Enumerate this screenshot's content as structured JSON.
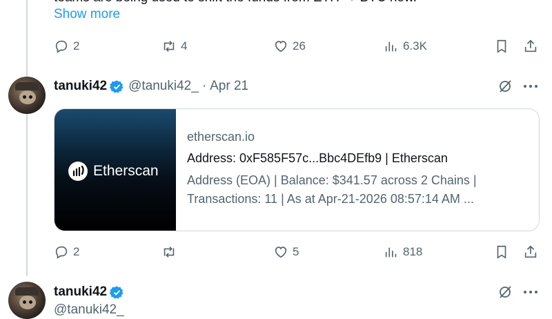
{
  "thread": {
    "cut_text": "teams are being used to shift the funds from ETH → BTC now.",
    "show_more": "Show more",
    "actions": {
      "replies": "2",
      "reposts": "4",
      "likes": "26",
      "views": "6.3K"
    }
  },
  "tweet1": {
    "display_name": "tanuki42",
    "handle": "@tanuki42_",
    "dot": "·",
    "date": "Apr 21",
    "card": {
      "logo_text": "Etherscan",
      "domain": "etherscan.io",
      "title": "Address: 0xF585F57c...Bbc4DEfb9 | Etherscan",
      "description": "Address (EOA) | Balance: $341.57 across 2 Chains | Transactions: 11 | As at Apr-21-2026 08:57:14 AM ..."
    },
    "actions": {
      "replies": "2",
      "reposts": "",
      "likes": "5",
      "views": "818"
    }
  },
  "tweet2": {
    "display_name": "tanuki42",
    "handle_partial": "@tanuki42_"
  },
  "colors": {
    "accent": "#1d9bf0",
    "muted": "#536471",
    "border": "#cfd9de"
  }
}
